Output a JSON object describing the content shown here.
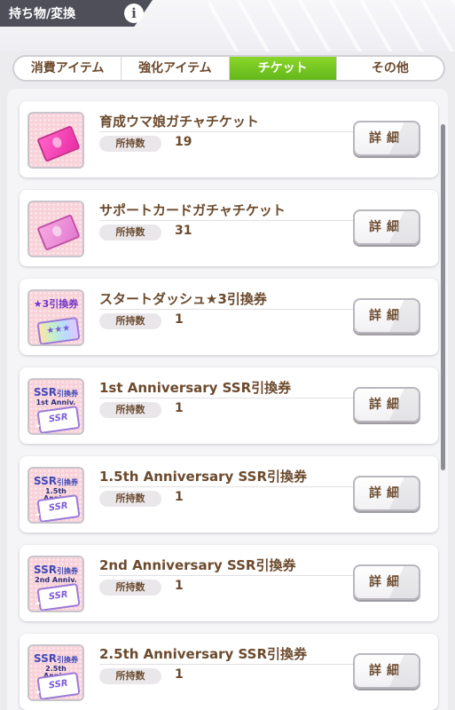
{
  "header": {
    "title": "持ち物/変換",
    "info_label": "i"
  },
  "tabs": [
    {
      "label": "消費アイテム",
      "active": false
    },
    {
      "label": "強化アイテム",
      "active": false
    },
    {
      "label": "チケット",
      "active": true
    },
    {
      "label": "その他",
      "active": false
    }
  ],
  "owned_label": "所持数",
  "detail_label": "詳細",
  "items": [
    {
      "name": "育成ウマ娘ガチャチケット",
      "count": "19",
      "icon": "pink-gacha-ticket-icon"
    },
    {
      "name": "サポートカードガチャチケット",
      "count": "31",
      "icon": "support-card-ticket-icon"
    },
    {
      "name": "スタートダッシュ★3引換券",
      "count": "1",
      "icon": "star3-exchange-ticket-icon",
      "badge": "★3引換券"
    },
    {
      "name": "1st Anniversary SSR引換券",
      "count": "1",
      "icon": "ssr-exchange-ticket-icon",
      "badge_main": "SSR",
      "badge_sub": "引換券",
      "anniv": "1st Anniv."
    },
    {
      "name": "1.5th Anniversary SSR引換券",
      "count": "1",
      "icon": "ssr-exchange-ticket-icon",
      "badge_main": "SSR",
      "badge_sub": "引換券",
      "anniv": "1.5th Anniv."
    },
    {
      "name": "2nd Anniversary SSR引換券",
      "count": "1",
      "icon": "ssr-exchange-ticket-icon",
      "badge_main": "SSR",
      "badge_sub": "引換券",
      "anniv": "2nd Anniv."
    },
    {
      "name": "2.5th Anniversary SSR引換券",
      "count": "1",
      "icon": "ssr-exchange-ticket-icon",
      "badge_main": "SSR",
      "badge_sub": "引換券",
      "anniv": "2.5th Anniv."
    }
  ],
  "ticket_face": "SSR",
  "colors": {
    "active_tab": "#6fc21f",
    "text_brown": "#6b4a2e",
    "thumb_pink": "#f8d2d8"
  }
}
